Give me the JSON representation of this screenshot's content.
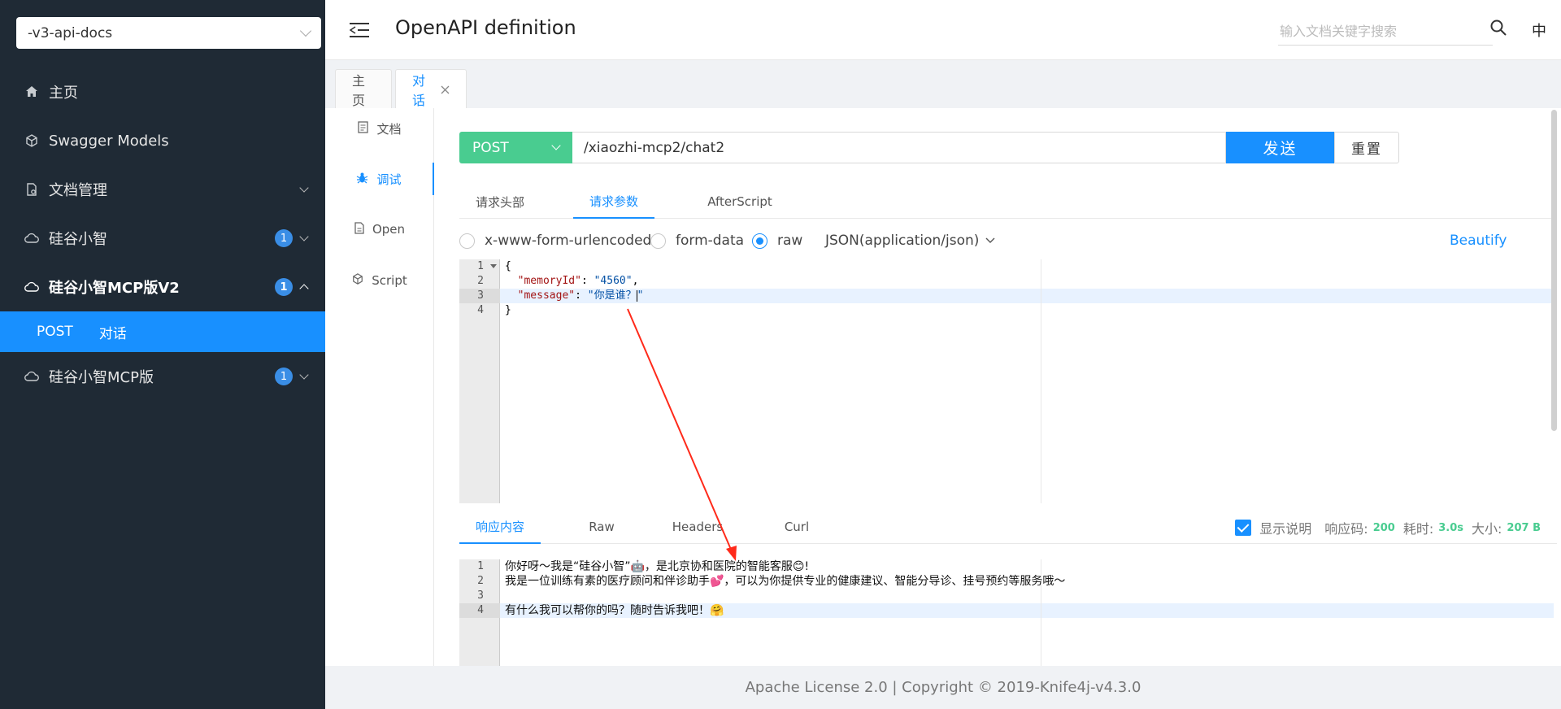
{
  "sidebar": {
    "group_select": "-v3-api-docs",
    "items": [
      {
        "label": "主页",
        "icon": "home-icon"
      },
      {
        "label": "Swagger Models",
        "icon": "cube-icon"
      },
      {
        "label": "文档管理",
        "icon": "doc-manage-icon"
      },
      {
        "label": "硅谷小智",
        "icon": "cloud-icon",
        "badge": "1"
      },
      {
        "label": "硅谷小智MCP版V2",
        "icon": "cloud-icon",
        "badge": "1"
      },
      {
        "label": "硅谷小智MCP版",
        "icon": "cloud-icon",
        "badge": "1"
      }
    ],
    "sub_item": {
      "method": "POST",
      "label": "对话"
    }
  },
  "header": {
    "title": "OpenAPI definition",
    "search_placeholder": "输入文档关键字搜索",
    "lang": "中"
  },
  "tabs": [
    {
      "label": "主页"
    },
    {
      "label": "对话",
      "close": "X"
    }
  ],
  "left_nav": [
    {
      "label": "文档",
      "icon": "document-icon"
    },
    {
      "label": "调试",
      "icon": "bug-icon"
    },
    {
      "label": "Open",
      "icon": "file-icon"
    },
    {
      "label": "Script",
      "icon": "cube-icon"
    }
  ],
  "request": {
    "method": "POST",
    "url": "/xiaozhi-mcp2/chat2",
    "send_label": "发送",
    "reset_label": "重置"
  },
  "sub_tabs": [
    "请求头部",
    "请求参数",
    "AfterScript"
  ],
  "body_types": {
    "options": [
      "x-www-form-urlencoded",
      "form-data",
      "raw"
    ],
    "selected": "raw",
    "content_type": "JSON(application/json)",
    "beautify": "Beautify"
  },
  "editor": {
    "line_numbers": [
      "1",
      "2",
      "3",
      "4"
    ],
    "lines": {
      "l1": "{",
      "l2_key": "\"memoryId\"",
      "l2_colon": ": ",
      "l2_val": "\"4560\"",
      "l2_tail": ",",
      "l3_key": "\"message\"",
      "l3_colon": ": ",
      "l3_val": "\"你是谁？",
      "l3_close": "\"",
      "l4": "}"
    }
  },
  "response_tabs": [
    "响应内容",
    "Raw",
    "Headers",
    "Curl"
  ],
  "response_meta": {
    "show_desc": "显示说明",
    "code_label": "响应码:",
    "code": "200",
    "time_label": "耗时:",
    "time": "3.0s",
    "size_label": "大小:",
    "size": "207 B"
  },
  "response": {
    "line_numbers": [
      "1",
      "2",
      "3",
      "4"
    ],
    "lines": [
      "你好呀～我是“硅谷小智”🤖，是北京协和医院的智能客服😊!",
      "我是一位训练有素的医疗顾问和伴诊助手💕，可以为你提供专业的健康建议、智能分导诊、挂号预约等服务哦～",
      "",
      "有什么我可以帮你的吗？随时告诉我吧！🤗"
    ]
  },
  "footer": "Apache License 2.0 | Copyright © 2019-Knife4j-v4.3.0",
  "colors": {
    "accent": "#1890ff",
    "post": "#49cc90",
    "sidebar": "#1f2a35",
    "annotation_arrow": "#ff2a1a"
  }
}
